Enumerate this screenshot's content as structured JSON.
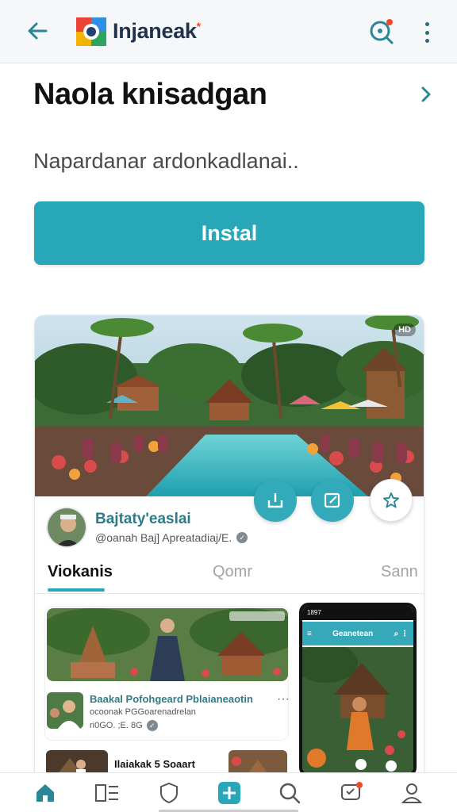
{
  "appbar": {
    "brand": "Injaneak",
    "brand_accent": "*",
    "icons": [
      "back-arrow-icon",
      "app-logo",
      "search-icon",
      "more-vert-icon"
    ]
  },
  "app": {
    "title": "Naola knisadgan",
    "description": "Napardanar ardonkadlanai..",
    "install_label": "Instal"
  },
  "card": {
    "hero_badge": "HD",
    "channel_name": "Bajtaty'easlai",
    "channel_handle": "@oanah Baj] Apreatadiaj/E.",
    "tabs": [
      {
        "label": "Viokanis",
        "active": true
      },
      {
        "label": "Qomr",
        "active": false
      },
      {
        "label": "Sann",
        "active": false
      }
    ],
    "post": {
      "title": "Baakal Pofohgeard Pblaianeaotin",
      "subtitle": "ocoonak PGGoarenadrelan",
      "meta": "ri0GO. ;E. 8G",
      "more": "···"
    },
    "post2": {
      "title": "Ilaiakak 5 Soaart"
    },
    "phone": {
      "status": "1897",
      "bar_label": "Geanetean"
    }
  },
  "bottom_nav": [
    "home-icon",
    "library-icon",
    "shield-icon",
    "add-icon",
    "search-icon",
    "chat-icon",
    "profile-icon"
  ],
  "colors": {
    "accent": "#27a7b8",
    "brand_text": "#22324d",
    "channel_text": "#2c7b87"
  }
}
